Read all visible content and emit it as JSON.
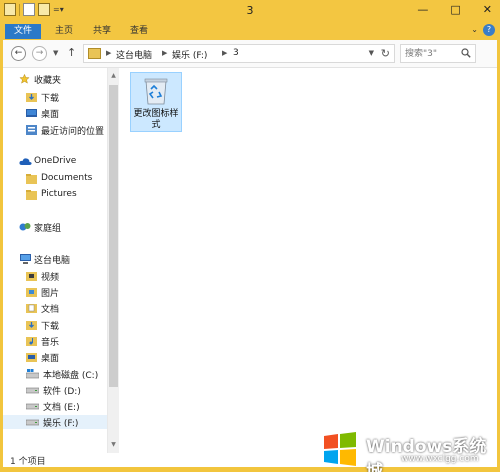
{
  "window": {
    "title": "3",
    "controls": [
      "—",
      "□",
      "✕"
    ]
  },
  "ribbon": {
    "tabs": [
      "文件",
      "主页",
      "共享",
      "查看"
    ],
    "help": "?"
  },
  "address": {
    "crumbs": [
      "这台电脑",
      "娱乐 (F:)",
      "3"
    ],
    "search_placeholder": "搜索\"3\""
  },
  "nav": {
    "favorites": {
      "label": "收藏夹",
      "items": [
        "下载",
        "桌面",
        "最近访问的位置"
      ]
    },
    "onedrive": {
      "label": "OneDrive",
      "items": [
        "Documents",
        "Pictures"
      ]
    },
    "homegroup": {
      "label": "家庭组"
    },
    "thispc": {
      "label": "这台电脑",
      "items": [
        "视频",
        "图片",
        "文档",
        "下载",
        "音乐",
        "桌面",
        "本地磁盘 (C:)",
        "软件 (D:)",
        "文档 (E:)",
        "娱乐 (F:)"
      ]
    }
  },
  "files": [
    {
      "name": "更改图标样式",
      "icon": "recycle-bin-icon"
    }
  ],
  "status": {
    "text": "1 个项目"
  },
  "watermark": {
    "title": "Windows系统城",
    "url": "www.wxclgg.com"
  },
  "colors": {
    "frame": "#f3c641",
    "file_tab": "#2b79c8",
    "selection": "#cce8ff"
  }
}
